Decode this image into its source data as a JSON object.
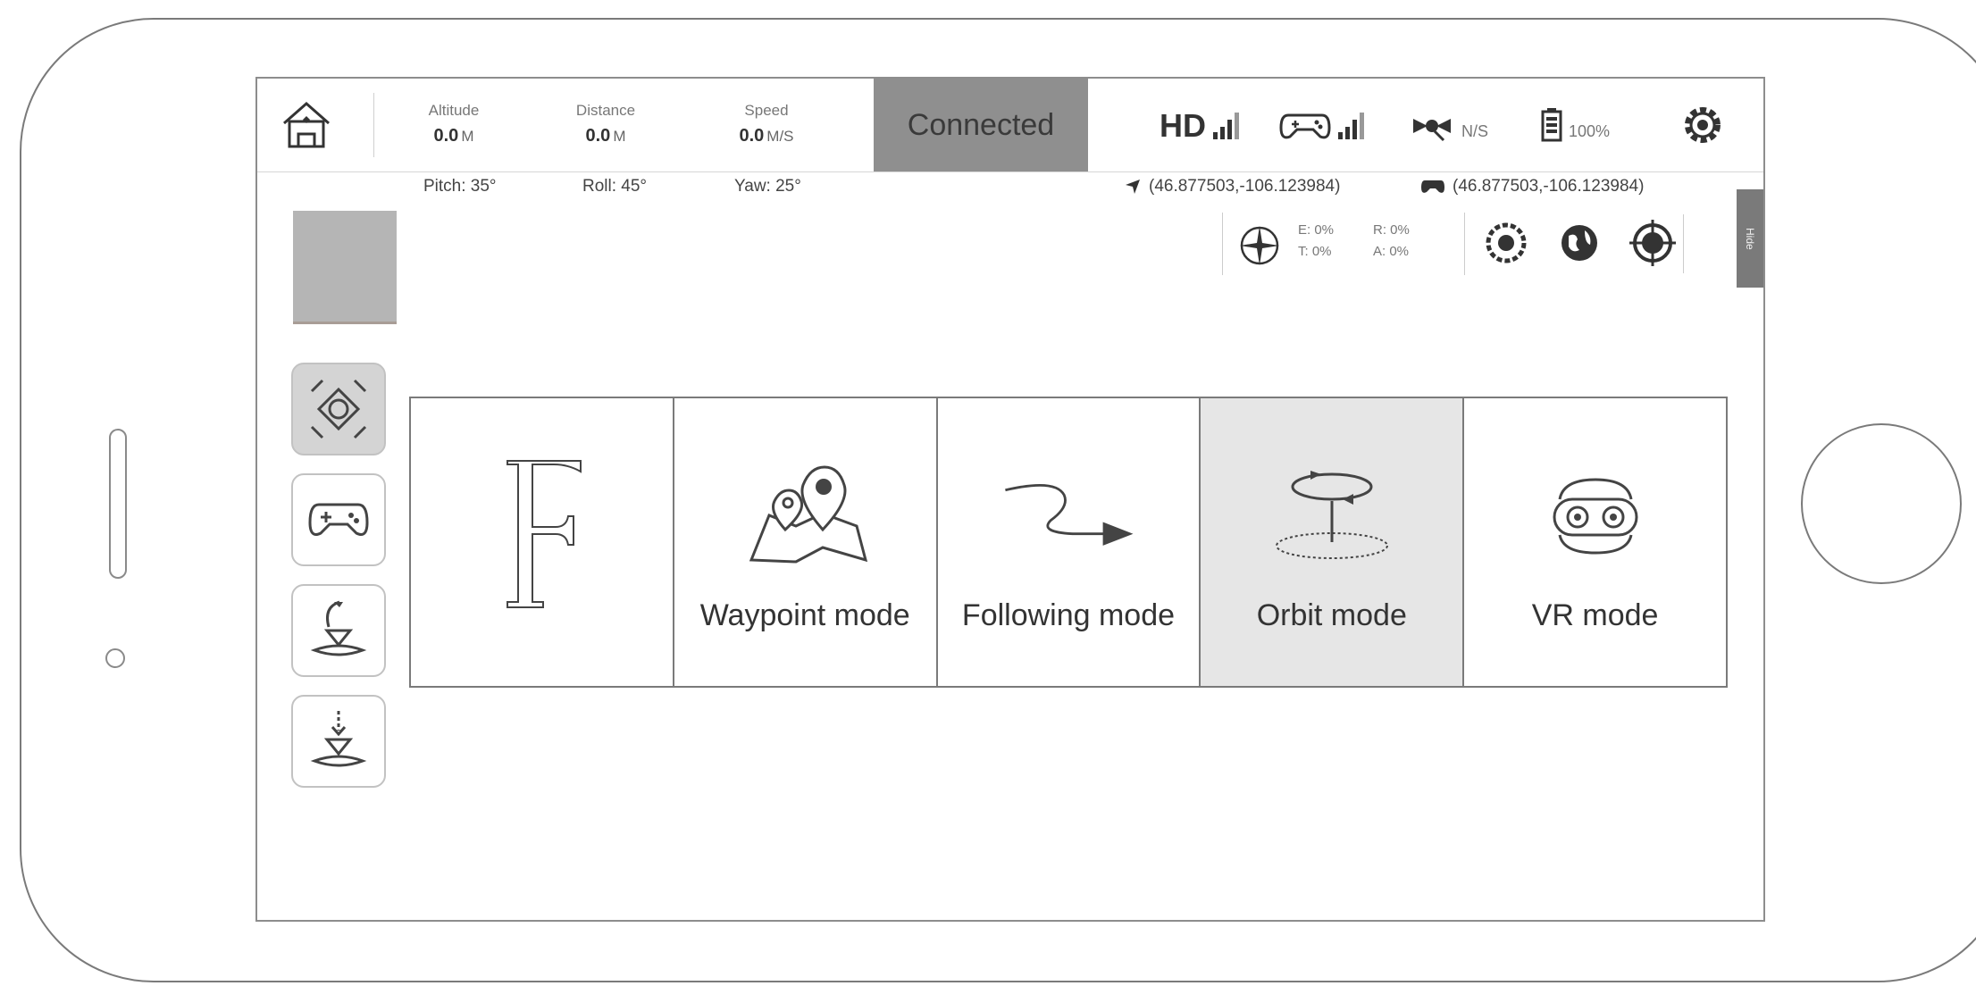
{
  "status": {
    "altitude": {
      "label": "Altitude",
      "value": "0.0",
      "unit": "M"
    },
    "distance": {
      "label": "Distance",
      "value": "0.0",
      "unit": "M"
    },
    "speed": {
      "label": "Speed",
      "value": "0.0",
      "unit": "M/S"
    },
    "connection": "Connected",
    "hd_label": "HD",
    "satellite_label": "N/S",
    "battery_label": "100%",
    "icons": [
      "home-icon",
      "hd-signal-icon",
      "gamepad-signal-icon",
      "satellite-icon",
      "battery-icon",
      "gear-icon"
    ]
  },
  "attitude": {
    "pitch": "Pitch: 35°",
    "roll": "Roll: 45°",
    "yaw": "Yaw: 25°"
  },
  "coords": {
    "drone": "(46.877503,-106.123984)",
    "controller": "(46.877503,-106.123984)"
  },
  "sensors": {
    "p1": "E: 0%",
    "p2": "R: 0%",
    "p3": "T: 0%",
    "p4": "A: 0%"
  },
  "side_tab": "Hide",
  "left_buttons": [
    "drone-mode-icon",
    "gamepad-icon",
    "takeoff-icon",
    "landing-icon"
  ],
  "modes": [
    {
      "label": "",
      "icon": "free-mode-icon"
    },
    {
      "label": "Waypoint mode",
      "icon": "map-pin-icon"
    },
    {
      "label": "Following mode",
      "icon": "follow-arrow-icon"
    },
    {
      "label": "Orbit mode",
      "icon": "orbit-icon",
      "selected": true
    },
    {
      "label": "VR mode",
      "icon": "vr-goggles-icon"
    }
  ],
  "colors": {
    "connected_bg": "#8f8f8f",
    "selected_mode_bg": "#e6e6e6"
  }
}
